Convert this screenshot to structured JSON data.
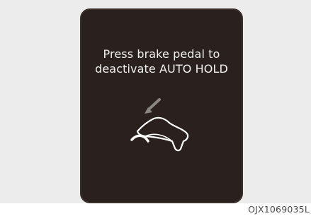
{
  "display": {
    "message_line1": "Press brake pedal to",
    "message_line2": "deactivate AUTO HOLD",
    "icon": "foot-on-brake-pedal-icon",
    "colors": {
      "panel_background": "#2a211e",
      "text": "#f1f1f1",
      "arrow": "#8a8582",
      "foot_outline": "#ffffff"
    }
  },
  "figure_code": "OJX1069035L"
}
